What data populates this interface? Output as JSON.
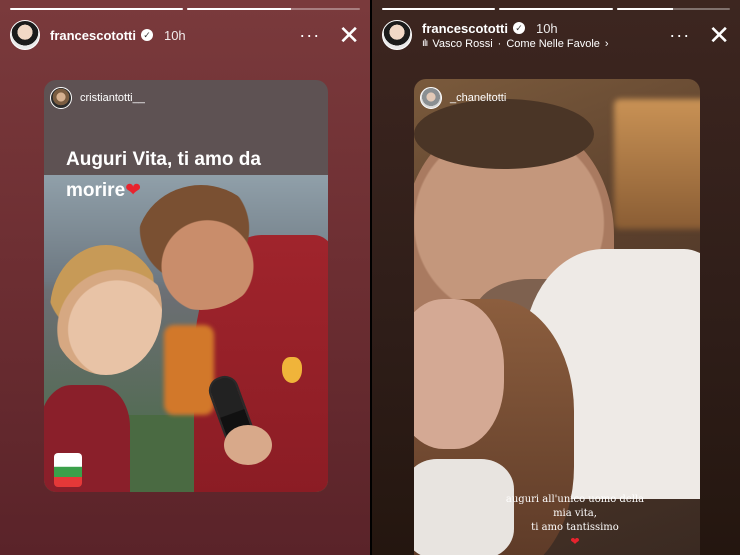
{
  "left_story": {
    "username": "francescototti",
    "time": "10h",
    "progress": [
      1.0,
      0.6
    ],
    "more_label": "···",
    "close_label": "✕",
    "repost": {
      "username": "cristiantotti__",
      "caption": "Auguri Vita, ti amo da morire",
      "emoji": "❤"
    }
  },
  "right_story": {
    "username": "francescototti",
    "time": "10h",
    "progress": [
      1.0,
      1.0,
      0.5
    ],
    "music": {
      "artist": "Vasco Rossi",
      "separator": "·",
      "title": "Come Nelle Favole",
      "chevron": "›"
    },
    "more_label": "···",
    "close_label": "✕",
    "repost": {
      "username": "_chaneltotti",
      "quote_line1": "auguri all'unico uomo della",
      "quote_line2": "mia vita,",
      "quote_line3": "ti amo tantissimo",
      "emoji": "❤"
    }
  },
  "colors": {
    "left_bg": "#6e2f33",
    "right_bg": "#2e1d18",
    "heart": "#e8232e"
  },
  "icons": {
    "verified": "verified-badge-icon",
    "more": "more-options-icon",
    "close": "close-icon",
    "music": "music-wave-icon"
  }
}
